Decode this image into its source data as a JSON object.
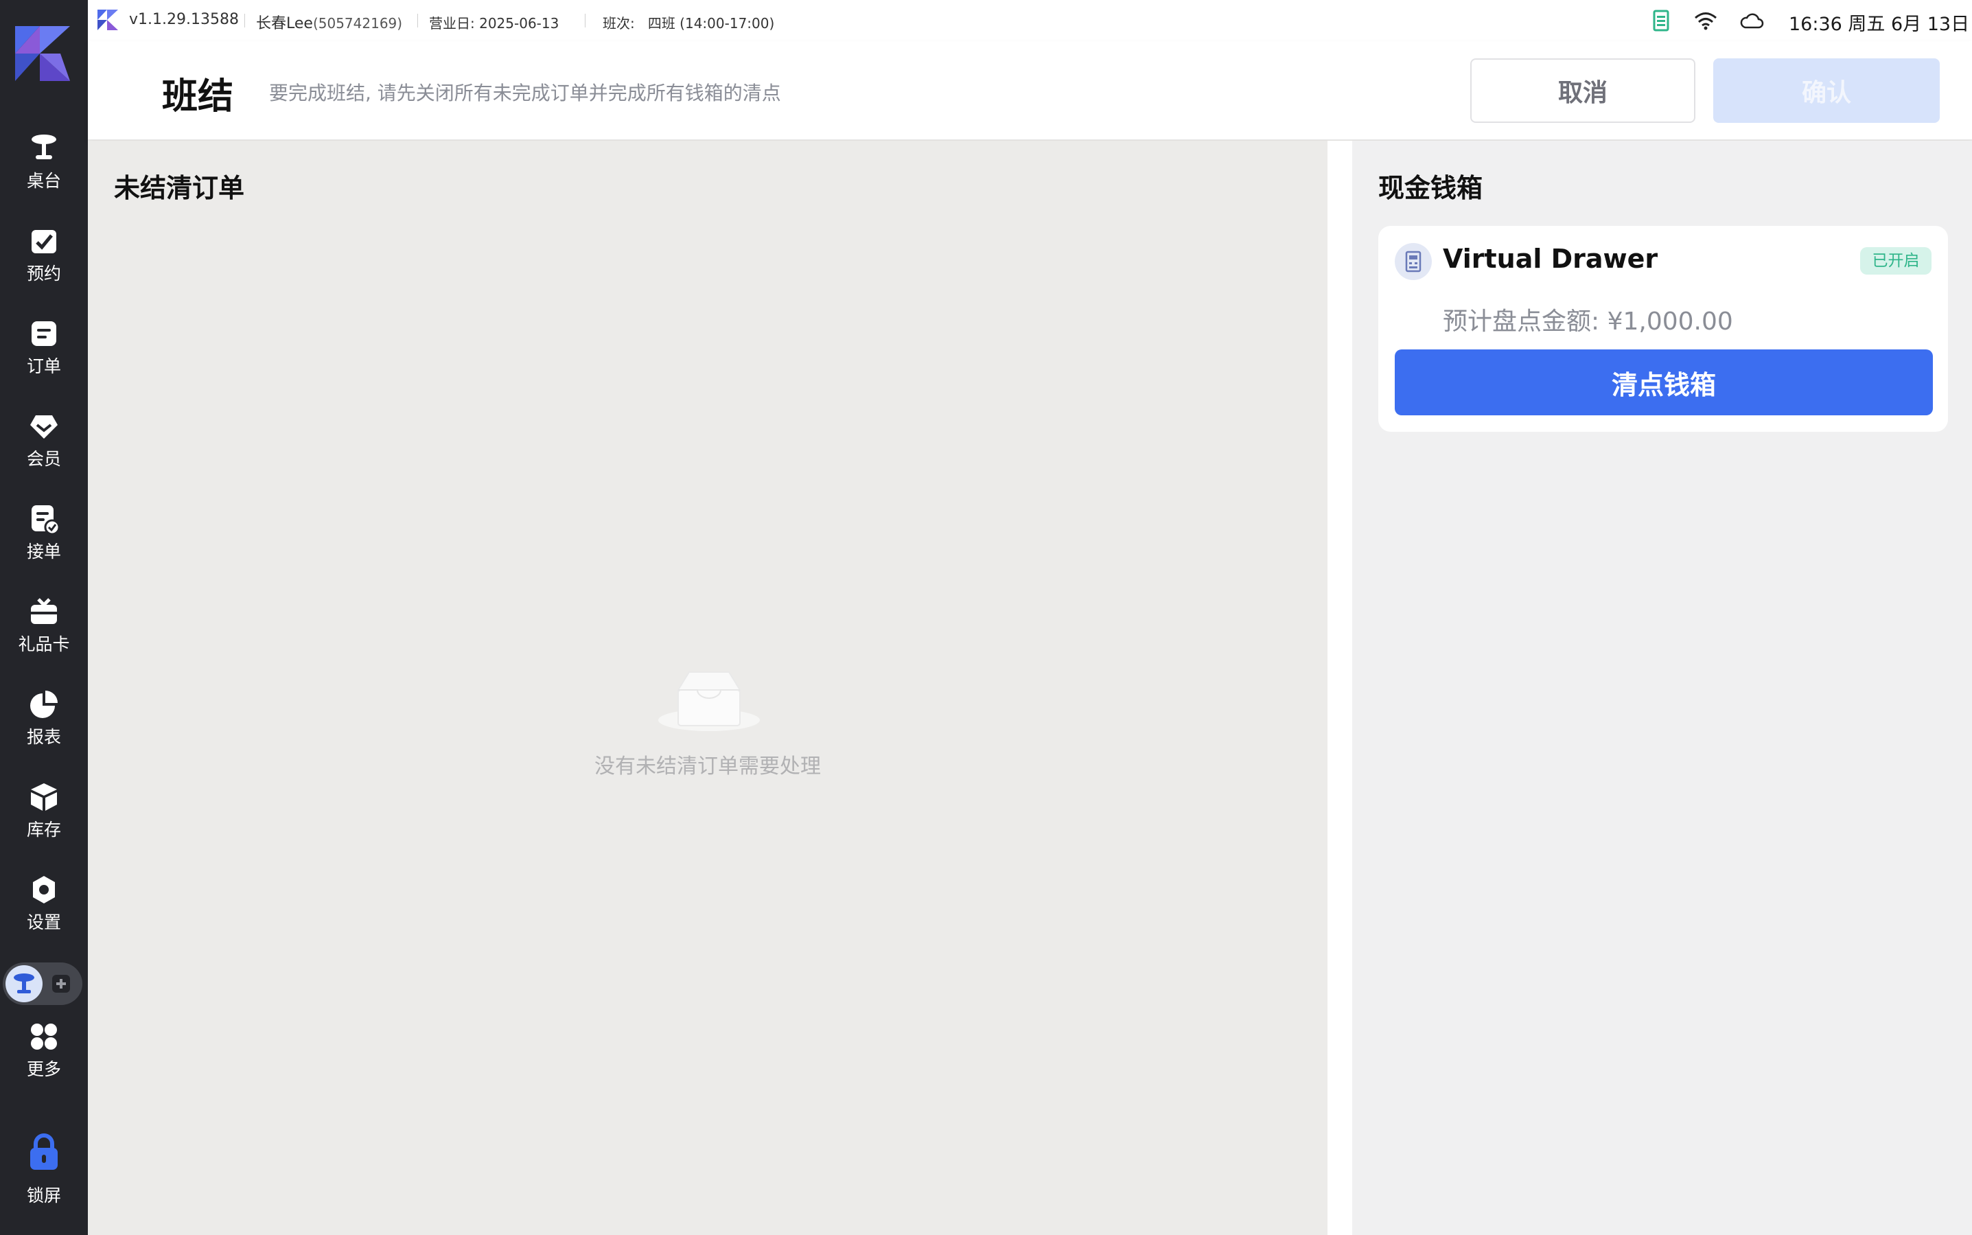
{
  "status_bar": {
    "version": "v1.1.29.13588",
    "user": "长春Lee",
    "user_id": "(505742169)",
    "business_day_label": "营业日:",
    "business_day": "2025-06-13",
    "shift_label": "班次:",
    "shift": "四班 (14:00-17:00)",
    "clock": "16:36 周五 6月 13日"
  },
  "sidebar": {
    "items": [
      {
        "label": "桌台",
        "icon": "table-icon"
      },
      {
        "label": "预约",
        "icon": "reservation-icon"
      },
      {
        "label": "订单",
        "icon": "orders-icon"
      },
      {
        "label": "会员",
        "icon": "member-icon"
      },
      {
        "label": "接单",
        "icon": "accept-order-icon"
      },
      {
        "label": "礼品卡",
        "icon": "gift-card-icon"
      },
      {
        "label": "报表",
        "icon": "report-icon"
      },
      {
        "label": "库存",
        "icon": "inventory-icon"
      },
      {
        "label": "设置",
        "icon": "settings-icon"
      },
      {
        "label": "更多",
        "icon": "more-icon"
      }
    ],
    "lock": {
      "label": "锁屏",
      "icon": "lock-icon"
    }
  },
  "header": {
    "title": "班结",
    "subtitle": "要完成班结, 请先关闭所有未完成订单并完成所有钱箱的清点",
    "cancel_label": "取消",
    "confirm_label": "确认"
  },
  "unsettled": {
    "title": "未结清订单",
    "empty_text": "没有未结清订单需要处理"
  },
  "cash_drawer": {
    "title": "现金钱箱",
    "drawer": {
      "name": "Virtual Drawer",
      "status": "已开启",
      "expected_amount": "预计盘点金额: ¥1,000.00",
      "count_button_label": "清点钱箱"
    }
  },
  "colors": {
    "sidebar_bg": "#24252a",
    "accent": "#3c6ef0",
    "confirm_disabled": "#d7e3fb",
    "badge_green": "#2fb58a"
  }
}
